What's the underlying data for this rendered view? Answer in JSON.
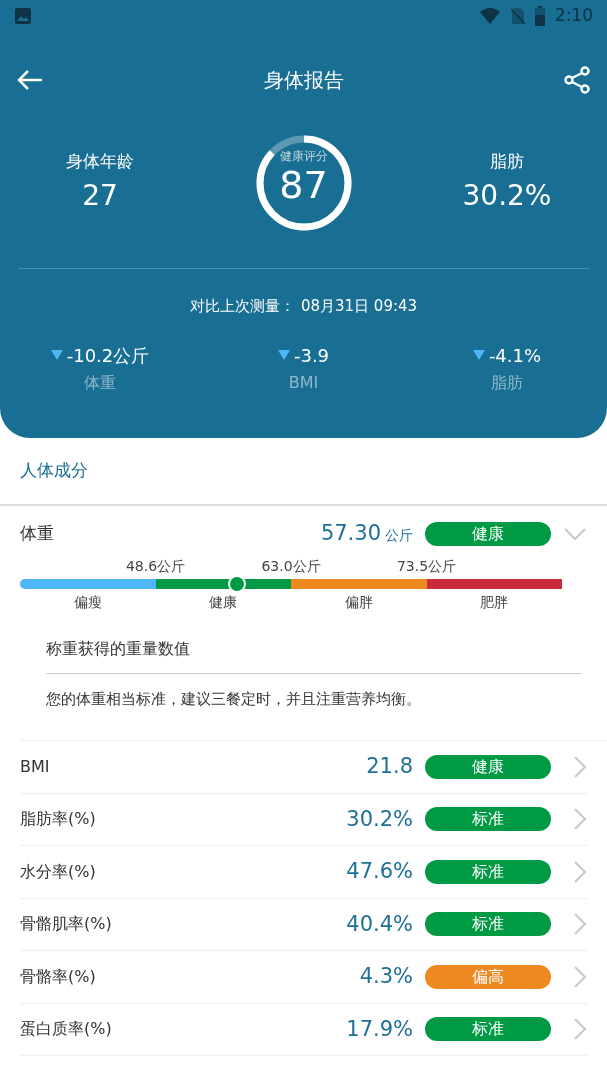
{
  "status_bar": {
    "time": "2:10"
  },
  "header": {
    "title": "身体报告"
  },
  "summary": {
    "left": {
      "label": "身体年龄",
      "value": "27"
    },
    "score": {
      "label": "健康评分",
      "value": "87",
      "level": 0.87
    },
    "right": {
      "label": "脂肪",
      "value": "30.2%"
    }
  },
  "comparison": {
    "label": "对比上次测量：",
    "date": "08月31日 09:43"
  },
  "deltas": [
    {
      "value": "-10.2公斤",
      "label": "体重"
    },
    {
      "value": "-3.9",
      "label": "BMI"
    },
    {
      "value": "-4.1%",
      "label": "脂肪"
    }
  ],
  "section_title": "人体成分",
  "weight": {
    "name": "体重",
    "value": "57.30",
    "unit": "公斤",
    "status": "健康",
    "color": "#009a44",
    "expanded": true,
    "level": 0.4,
    "thresholds": [
      "48.6公斤",
      "63.0公斤",
      "73.5公斤"
    ],
    "ranges": [
      {
        "label": "偏瘦",
        "color": "#4db6f5"
      },
      {
        "label": "健康",
        "color": "#009a44"
      },
      {
        "label": "偏胖",
        "color": "#ee8820"
      },
      {
        "label": "肥胖",
        "color": "#cc2a3d"
      }
    ],
    "description": "称重获得的重量数值",
    "advice": "您的体重相当标准，建议三餐定时，并且注重营养均衡。"
  },
  "metrics": [
    {
      "name": "BMI",
      "value": "21.8",
      "status": "健康",
      "color": "#009a44"
    },
    {
      "name": "脂肪率(%)",
      "value": "30.2%",
      "status": "标准",
      "color": "#009a44"
    },
    {
      "name": "水分率(%)",
      "value": "47.6%",
      "status": "标准",
      "color": "#009a44"
    },
    {
      "name": "骨骼肌率(%)",
      "value": "40.4%",
      "status": "标准",
      "color": "#009a44"
    },
    {
      "name": "骨骼率(%)",
      "value": "4.3%",
      "status": "偏高",
      "color": "#ee8820"
    },
    {
      "name": "蛋白质率(%)",
      "value": "17.9%",
      "status": "标准",
      "color": "#009a44"
    }
  ]
}
